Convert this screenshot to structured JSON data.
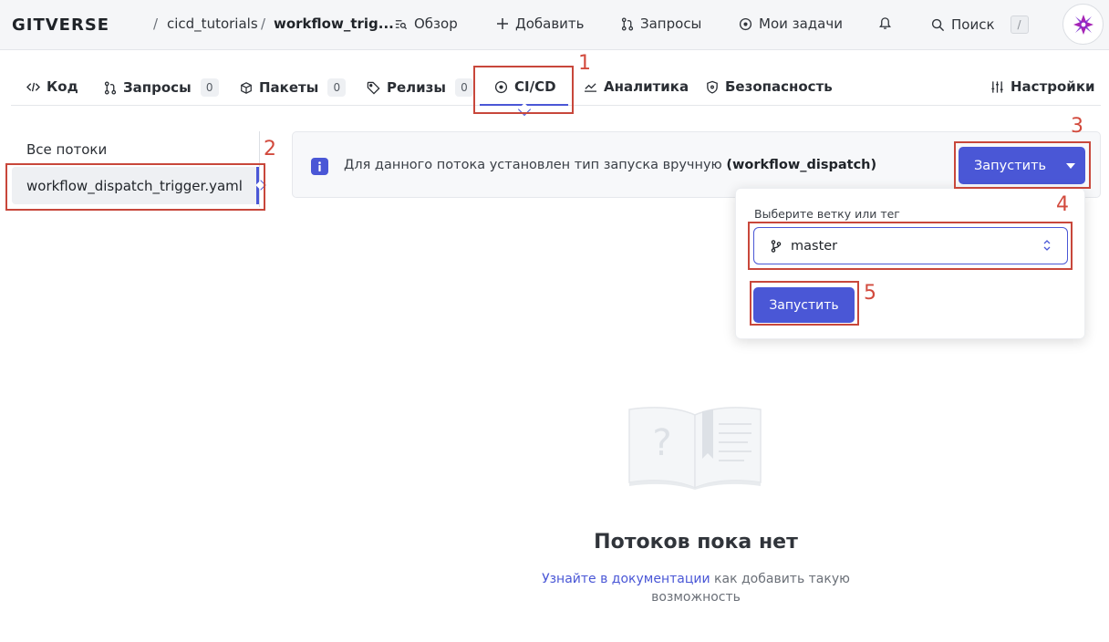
{
  "header": {
    "logo": "GITVERSE",
    "breadcrumb_sep": "/",
    "repo_owner": "cicd_tutorials",
    "repo_name": "workflow_trig...",
    "nav": [
      {
        "label": "Обзор",
        "icon": "overview-icon"
      },
      {
        "label": "Добавить",
        "icon": "plus-icon"
      },
      {
        "label": "Запросы",
        "icon": "pull-request-icon"
      },
      {
        "label": "Мои задачи",
        "icon": "tasks-icon"
      }
    ],
    "search_label": "Поиск",
    "search_shortcut": "/"
  },
  "tabs": [
    {
      "label": "Код",
      "icon": "code-icon"
    },
    {
      "label": "Запросы",
      "count": "0",
      "icon": "pull-request-icon"
    },
    {
      "label": "Пакеты",
      "count": "0",
      "icon": "package-icon"
    },
    {
      "label": "Релизы",
      "count": "0",
      "icon": "tag-icon"
    },
    {
      "label": "CI/CD",
      "icon": "ci-cd-icon",
      "active": true
    },
    {
      "label": "Аналитика",
      "icon": "chart-icon"
    },
    {
      "label": "Безопасность",
      "icon": "shield-icon"
    },
    {
      "label": "Настройки",
      "icon": "settings-icon"
    }
  ],
  "sidebar": {
    "heading": "Все потоки",
    "items": [
      {
        "label": "workflow_dispatch_trigger.yaml",
        "active": true
      }
    ]
  },
  "banner": {
    "text": "Для данного потока установлен тип запуска вручную",
    "code": "(workflow_dispatch)",
    "run_button": "Запустить"
  },
  "dropdown": {
    "label": "Выберите ветку или тег",
    "branch": "master",
    "run_button": "Запустить"
  },
  "empty_state": {
    "title": "Потоков пока нет",
    "link_text": "Узнайте в документации",
    "desc_rest": " как добавить такую возможность"
  },
  "annotations": [
    "1",
    "2",
    "3",
    "4",
    "5"
  ],
  "colors": {
    "accent": "#4a57d6",
    "annotation": "#c8473b"
  }
}
